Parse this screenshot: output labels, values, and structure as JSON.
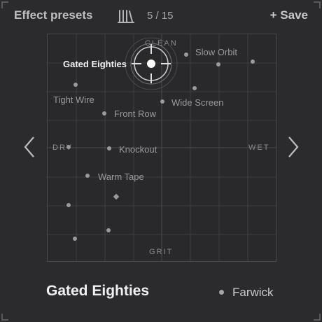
{
  "header": {
    "title": "Effect presets",
    "count": "5 / 15",
    "save_label": "+ Save"
  },
  "axes": {
    "top": "CLEAN",
    "bottom": "GRIT",
    "left": "DRY",
    "right": "WET"
  },
  "selected": {
    "name": "Gated Eighties",
    "author": "Farwick"
  },
  "presets": {
    "slow_orbit": "Slow Orbit",
    "tight_wire": "Tight Wire",
    "wide_screen": "Wide Screen",
    "front_row": "Front Row",
    "knockout": "Knockout",
    "warm_tape": "Warm Tape"
  },
  "icons": {
    "library": "library-icon",
    "prev": "chevron-left-icon",
    "next": "chevron-right-icon",
    "crosshair": "crosshair-icon"
  },
  "colors": {
    "background": "#2b2b2d",
    "selected": "#f2f2f2",
    "point": "#9a9a9c"
  }
}
